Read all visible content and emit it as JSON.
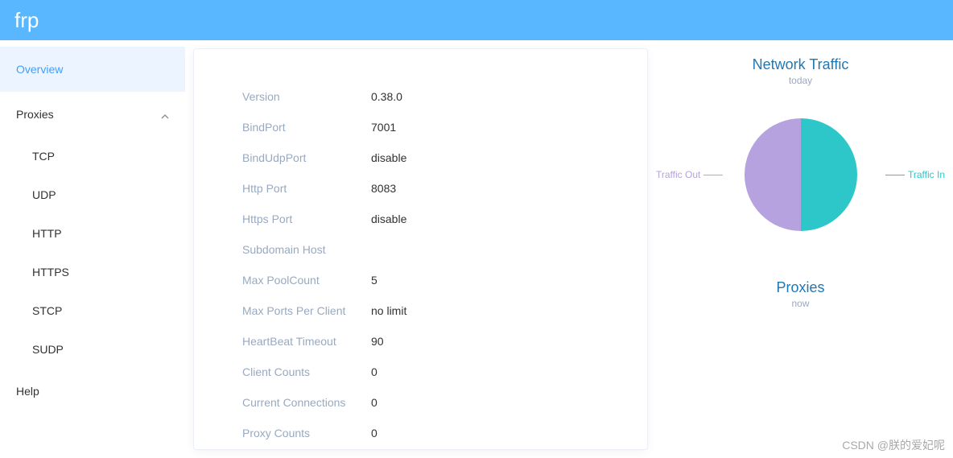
{
  "header": {
    "title": "frp"
  },
  "sidebar": {
    "overview": "Overview",
    "proxies": "Proxies",
    "sub": {
      "tcp": "TCP",
      "udp": "UDP",
      "http": "HTTP",
      "https": "HTTPS",
      "stcp": "STCP",
      "sudp": "SUDP"
    },
    "help": "Help"
  },
  "overview": {
    "rows": {
      "version_l": "Version",
      "version_v": "0.38.0",
      "bindport_l": "BindPort",
      "bindport_v": "7001",
      "bindudp_l": "BindUdpPort",
      "bindudp_v": "disable",
      "http_l": "Http Port",
      "http_v": "8083",
      "https_l": "Https Port",
      "https_v": "disable",
      "subdom_l": "Subdomain Host",
      "subdom_v": "",
      "pool_l": "Max PoolCount",
      "pool_v": "5",
      "ports_l": "Max Ports Per Client",
      "ports_v": "no limit",
      "hb_l": "HeartBeat Timeout",
      "hb_v": "90",
      "clients_l": "Client Counts",
      "clients_v": "0",
      "conn_l": "Current Connections",
      "conn_v": "0",
      "proxy_l": "Proxy Counts",
      "proxy_v": "0"
    }
  },
  "charts": {
    "traffic_title": "Network Traffic",
    "traffic_sub": "today",
    "traffic_out": "Traffic Out",
    "traffic_in": "Traffic In",
    "proxies_title": "Proxies",
    "proxies_sub": "now"
  },
  "chart_data": {
    "type": "pie",
    "title": "Network Traffic",
    "subtitle": "today",
    "series": [
      {
        "name": "Traffic In",
        "value": 50,
        "color": "#2ec7c9"
      },
      {
        "name": "Traffic Out",
        "value": 50,
        "color": "#b6a2de"
      }
    ]
  },
  "watermark": "CSDN @朕的爱妃呢"
}
